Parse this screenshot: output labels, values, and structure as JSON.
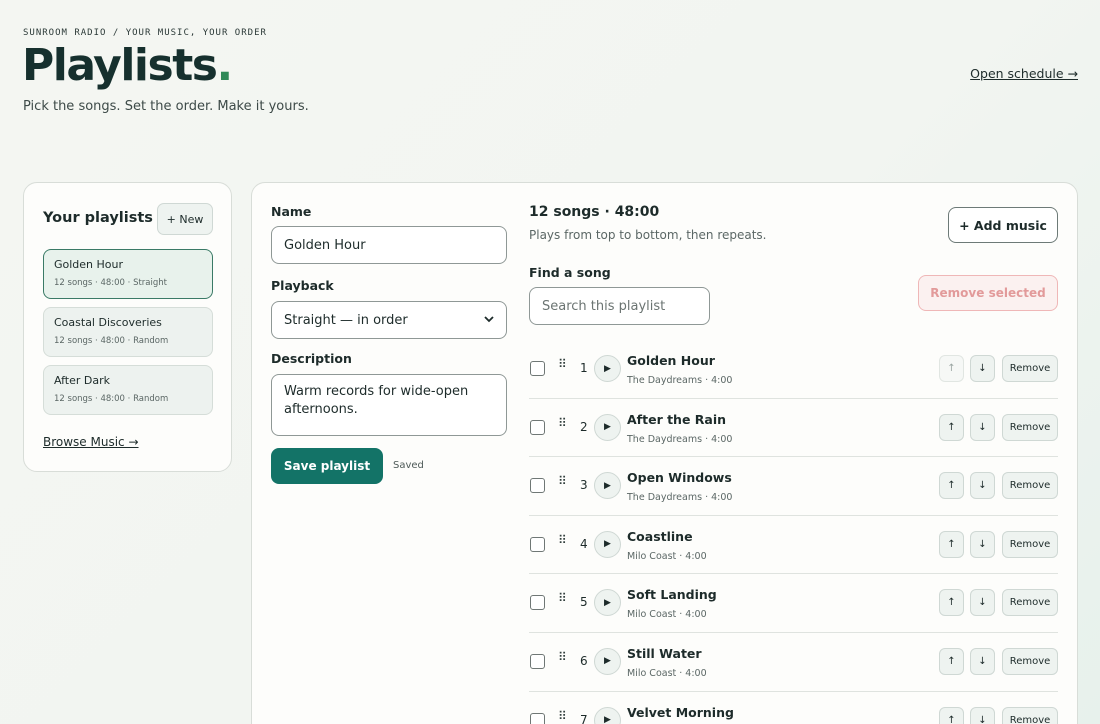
{
  "header": {
    "eyebrow": "SUNROOM RADIO / YOUR MUSIC, YOUR ORDER",
    "title": "Playlists",
    "title_dot": ".",
    "subtitle": "Pick the songs. Set the order. Make it yours.",
    "schedule_link": "Open schedule →"
  },
  "sidebar": {
    "heading": "Your playlists",
    "new_button": "+ New",
    "playlists": [
      {
        "name": "Golden Hour",
        "meta": "12 songs · 48:00 · Straight",
        "active": true
      },
      {
        "name": "Coastal Discoveries",
        "meta": "12 songs · 48:00 · Random",
        "active": false
      },
      {
        "name": "After Dark",
        "meta": "12 songs · 48:00 · Random",
        "active": false
      }
    ],
    "browse_link": "Browse Music →"
  },
  "editor": {
    "name_label": "Name",
    "name_value": "Golden Hour",
    "playback_label": "Playback",
    "playback_value": "Straight — in order",
    "description_label": "Description",
    "description_value": "Warm records for wide-open afternoons.",
    "save_button": "Save playlist",
    "save_status": "Saved"
  },
  "songs_panel": {
    "summary": "12 songs · 48:00",
    "summary_sub": "Plays from top to bottom, then repeats.",
    "add_button": "+ Add music",
    "find_label": "Find a song",
    "search_placeholder": "Search this playlist",
    "remove_selected": "Remove selected",
    "remove_label": "Remove",
    "play_glyph": "▶",
    "grip_glyph": "⠿",
    "up_glyph": "↑",
    "down_glyph": "↓",
    "songs": [
      {
        "num": "1",
        "title": "Golden Hour",
        "meta": "The Daydreams · 4:00",
        "up_disabled": true
      },
      {
        "num": "2",
        "title": "After the Rain",
        "meta": "The Daydreams · 4:00",
        "up_disabled": false
      },
      {
        "num": "3",
        "title": "Open Windows",
        "meta": "The Daydreams · 4:00",
        "up_disabled": false
      },
      {
        "num": "4",
        "title": "Coastline",
        "meta": "Milo Coast · 4:00",
        "up_disabled": false
      },
      {
        "num": "5",
        "title": "Soft Landing",
        "meta": "Milo Coast · 4:00",
        "up_disabled": false
      },
      {
        "num": "6",
        "title": "Still Water",
        "meta": "Milo Coast · 4:00",
        "up_disabled": false
      },
      {
        "num": "7",
        "title": "Velvet Morning",
        "meta": "",
        "up_disabled": false
      }
    ]
  },
  "colors": {
    "accent": "#137367",
    "title_dot": "#2f8a58",
    "danger_text": "#e29a9a"
  }
}
